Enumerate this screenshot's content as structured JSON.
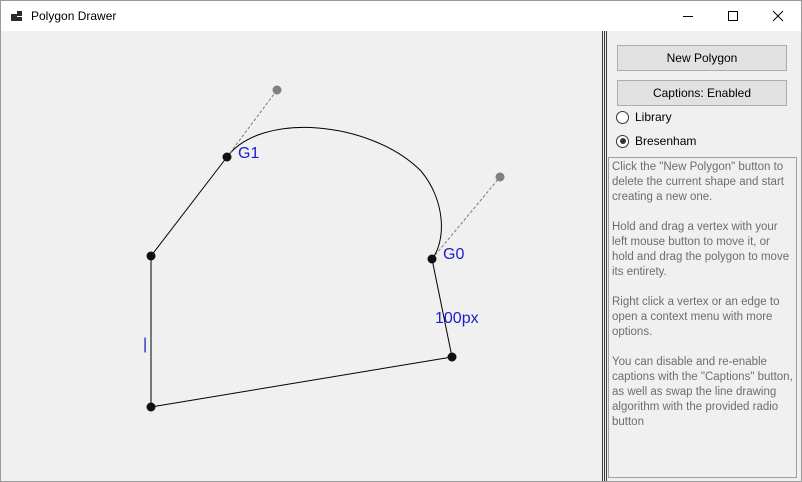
{
  "window": {
    "title": "Polygon Drawer"
  },
  "titlebar_controls": {
    "minimize_icon": "minimize-icon",
    "maximize_icon": "maximize-icon",
    "close_icon": "close-icon"
  },
  "panel": {
    "new_polygon_label": "New Polygon",
    "captions_label": "Captions: Enabled",
    "algorithm_options": [
      {
        "label": "Library",
        "checked": false
      },
      {
        "label": "Bresenham",
        "checked": true
      }
    ],
    "help_paragraphs": [
      "Click the \"New Polygon\" button to delete the current shape and start creating a new one.",
      "Hold and drag a vertex with your left mouse button to move it, or hold and drag the polygon to move its entirety.",
      "Right click a vertex or an edge to open a context menu with more options.",
      "You can disable and re-enable captions with the \"Captions\" button, as well as swap the line drawing algorithm with the provided radio button"
    ]
  },
  "canvas": {
    "captions": {
      "g1": "G1",
      "g0": "G0",
      "edge_length": "100px",
      "vertical_marker": "|"
    },
    "colors": {
      "caption": "#1c1ccc",
      "vertex": "#111111",
      "control_point": "#808080"
    }
  }
}
